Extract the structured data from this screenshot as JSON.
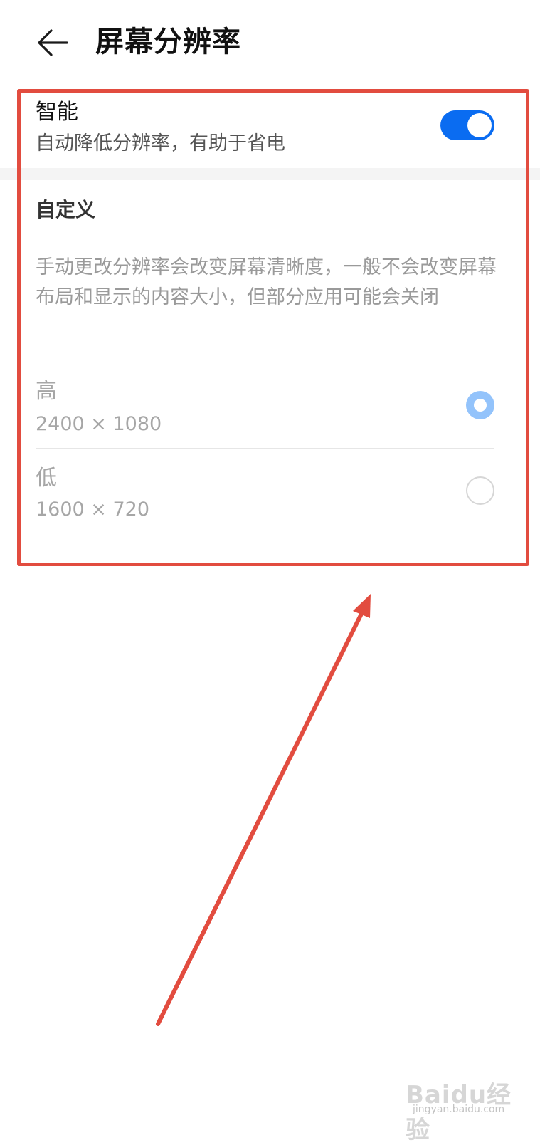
{
  "header": {
    "back_icon": "arrow-left-icon",
    "title": "屏幕分辨率"
  },
  "smart": {
    "title": "智能",
    "description": "自动降低分辨率，有助于省电",
    "toggle_on": true,
    "accent_color": "#0a6cf1"
  },
  "custom": {
    "header": "自定义",
    "description": "手动更改分辨率会改变屏幕清晰度，一般不会改变屏幕布局和显示的内容大小，但部分应用可能会关闭",
    "options": [
      {
        "label": "高",
        "value": "2400 × 1080",
        "selected": true
      },
      {
        "label": "低",
        "value": "1600 × 720",
        "selected": false
      }
    ]
  },
  "annotation": {
    "color": "#e24c3f"
  },
  "watermark": {
    "text": "Baidu经验",
    "sub": "jingyan.baidu.com"
  }
}
